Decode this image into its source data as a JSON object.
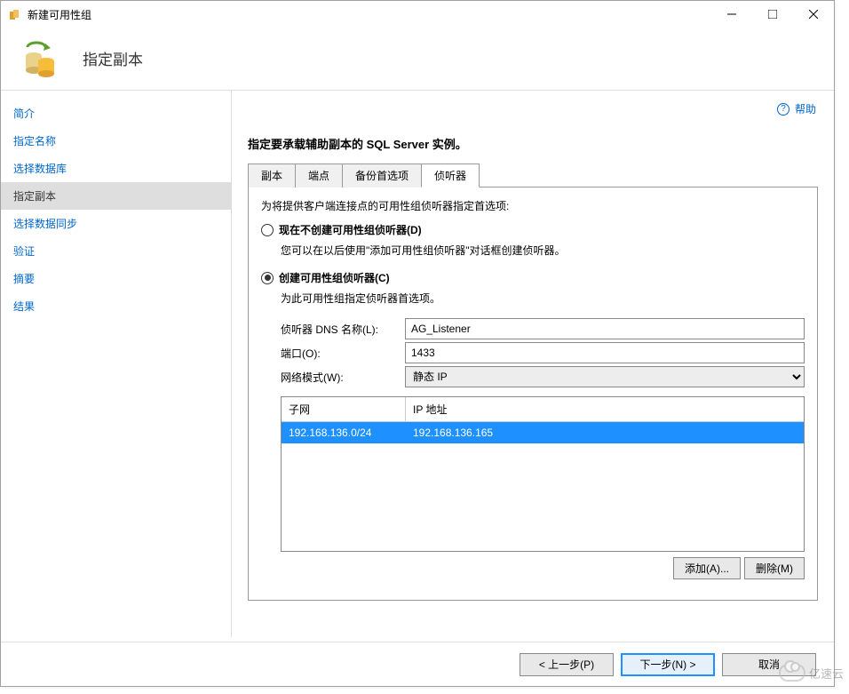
{
  "titlebar": {
    "title": "新建可用性组"
  },
  "header": {
    "title": "指定副本"
  },
  "sidebar": {
    "items": [
      {
        "label": "简介",
        "active": false
      },
      {
        "label": "指定名称",
        "active": false
      },
      {
        "label": "选择数据库",
        "active": false
      },
      {
        "label": "指定副本",
        "active": true
      },
      {
        "label": "选择数据同步",
        "active": false
      },
      {
        "label": "验证",
        "active": false
      },
      {
        "label": "摘要",
        "active": false
      },
      {
        "label": "结果",
        "active": false
      }
    ]
  },
  "main": {
    "help": "帮助",
    "heading": "指定要承载辅助副本的 SQL Server 实例。",
    "tabs": [
      {
        "label": "副本",
        "active": false
      },
      {
        "label": "端点",
        "active": false
      },
      {
        "label": "备份首选项",
        "active": false
      },
      {
        "label": "侦听器",
        "active": true
      }
    ],
    "listener": {
      "instruction": "为将提供客户端连接点的可用性组侦听器指定首选项:",
      "radio_no_label": "现在不创建可用性组侦听器(D)",
      "radio_no_desc": "您可以在以后使用\"添加可用性组侦听器\"对话框创建侦听器。",
      "radio_yes_label": "创建可用性组侦听器(C)",
      "radio_yes_desc": "为此可用性组指定侦听器首选项。",
      "dns_label": "侦听器 DNS 名称(L):",
      "dns_value": "AG_Listener",
      "port_label": "端口(O):",
      "port_value": "1433",
      "netmode_label": "网络模式(W):",
      "netmode_value": "静态 IP",
      "table": {
        "col_subnet": "子网",
        "col_ip": "IP 地址",
        "rows": [
          {
            "subnet": "192.168.136.0/24",
            "ip": "192.168.136.165"
          }
        ]
      },
      "btn_add": "添加(A)...",
      "btn_remove": "删除(M)"
    }
  },
  "footer": {
    "prev": "< 上一步(P)",
    "next": "下一步(N) >",
    "cancel": "取消"
  },
  "watermark": "亿速云"
}
